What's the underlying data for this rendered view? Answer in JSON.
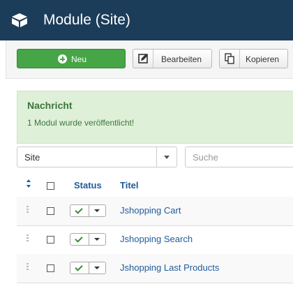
{
  "header": {
    "title": "Module (Site)",
    "logo_icon": "cube-icon",
    "background": "#1c3d5a"
  },
  "toolbar": {
    "new_label": "Neu",
    "new_icon": "plus-circle-icon",
    "edit_label": "Bearbeiten",
    "edit_icon": "edit-icon",
    "copy_label": "Kopieren",
    "copy_icon": "copy-icon",
    "new_color": "#46a546"
  },
  "alert": {
    "heading": "Nachricht",
    "message": "1 Modul wurde veröffentlicht!",
    "background": "#dff0d8"
  },
  "filters": {
    "client_value": "Site",
    "search_placeholder": "Suche"
  },
  "table": {
    "columns": {
      "sort_icon": "sort-icon",
      "status": "Status",
      "title": "Titel"
    },
    "rows": [
      {
        "title": "Jshopping Cart",
        "published": true
      },
      {
        "title": "Jshopping Search",
        "published": true
      },
      {
        "title": "Jshopping Last Products",
        "published": true
      }
    ]
  }
}
